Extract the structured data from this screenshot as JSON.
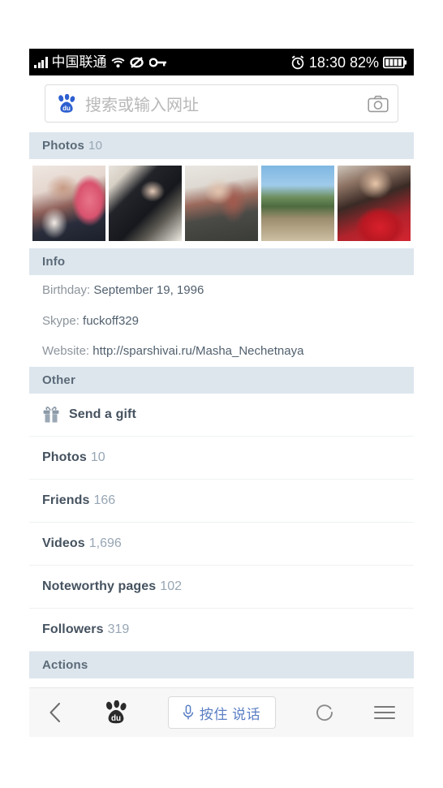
{
  "statusbar": {
    "carrier": "中国联通",
    "time": "18:30",
    "battery_percent": "82%",
    "icons": [
      "signal-bars-icon",
      "wifi-icon",
      "vpn-icon",
      "key-icon",
      "alarm-clock-icon",
      "battery-icon"
    ]
  },
  "search": {
    "placeholder": "搜索或输入网址",
    "logo": "baidu-paw-icon",
    "camera": "camera-icon"
  },
  "photos_section": {
    "title": "Photos",
    "count": "10",
    "thumbnails": [
      {
        "name": "photo-thumbnail-1"
      },
      {
        "name": "photo-thumbnail-2"
      },
      {
        "name": "photo-thumbnail-3"
      },
      {
        "name": "photo-thumbnail-4"
      },
      {
        "name": "photo-thumbnail-5"
      }
    ]
  },
  "info_section": {
    "title": "Info",
    "rows": [
      {
        "label": "Birthday:",
        "value": "September 19, 1996"
      },
      {
        "label": "Skype:",
        "value": "fuckoff329"
      },
      {
        "label": "Website:",
        "value": "http://sparshivai.ru/Masha_Nechetnaya"
      }
    ]
  },
  "other_section": {
    "title": "Other",
    "rows": [
      {
        "label": "Send a gift",
        "count": "",
        "icon": "gift-icon"
      },
      {
        "label": "Photos",
        "count": "10",
        "icon": ""
      },
      {
        "label": "Friends",
        "count": "166",
        "icon": ""
      },
      {
        "label": "Videos",
        "count": "1,696",
        "icon": ""
      },
      {
        "label": "Noteworthy pages",
        "count": "102",
        "icon": ""
      },
      {
        "label": "Followers",
        "count": "319",
        "icon": ""
      }
    ]
  },
  "actions_section": {
    "title": "Actions"
  },
  "bottombar": {
    "back": "back-chevron-icon",
    "home": "baidu-paw-icon",
    "voice_label": "按住 说话",
    "mic": "microphone-icon",
    "refresh": "refresh-icon",
    "menu": "menu-icon"
  },
  "colors": {
    "section_header_bg": "#dde6ed",
    "section_header_text": "#5b6a78",
    "accent_blue": "#5a7fc4",
    "count_gray": "#97a6b4",
    "bottombar_bg": "#f7f7f7"
  }
}
